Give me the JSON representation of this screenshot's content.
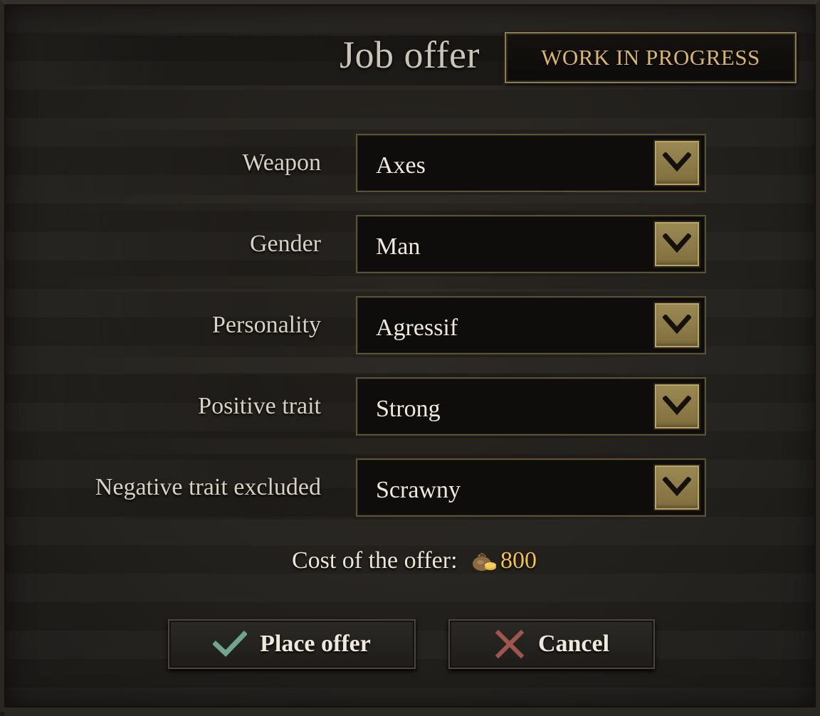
{
  "dialog": {
    "title": "Job offer",
    "status_badge": "WORK IN PROGRESS"
  },
  "fields": [
    {
      "label": "Weapon",
      "value": "Axes"
    },
    {
      "label": "Gender",
      "value": "Man"
    },
    {
      "label": "Personality",
      "value": "Agressif"
    },
    {
      "label": "Positive trait",
      "value": "Strong"
    },
    {
      "label": "Negative trait excluded",
      "value": "Scrawny"
    }
  ],
  "cost": {
    "label": "Cost of the offer:",
    "amount": "800",
    "icon": "money-bag-icon"
  },
  "actions": {
    "place_offer_label": "Place offer",
    "cancel_label": "Cancel"
  },
  "colors": {
    "gold_text": "#d9b66a",
    "cost_amount": "#f0c24a",
    "check_icon": "#6fa58c",
    "cancel_icon": "#a0564f",
    "dropdown_button": "#9c8a54"
  }
}
